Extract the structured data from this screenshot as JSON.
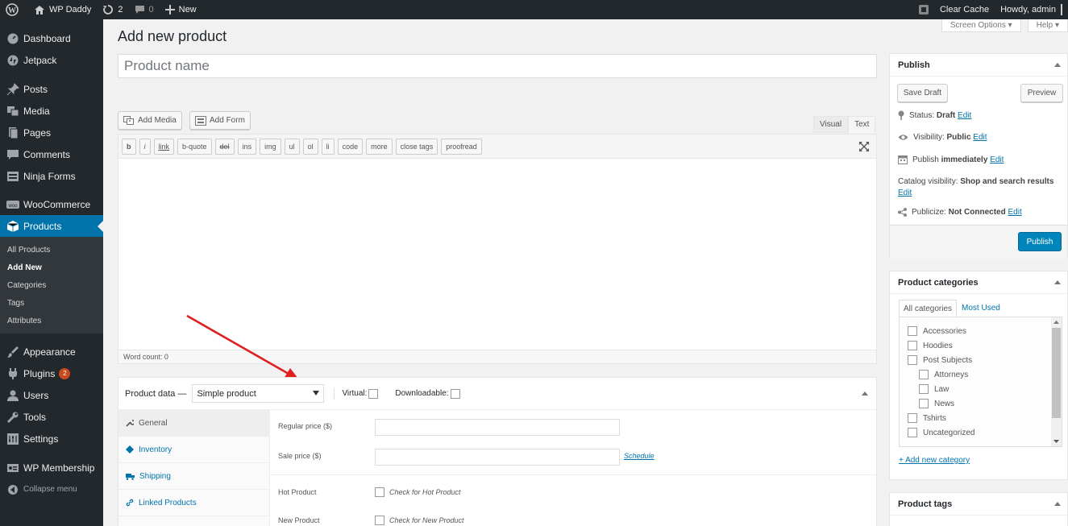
{
  "adminbar": {
    "site_name": "WP Daddy",
    "updates_count": "2",
    "comments_count": "0",
    "new_label": "New",
    "clear_cache": "Clear Cache",
    "howdy": "Howdy, admin"
  },
  "screen_options": {
    "screen_options_label": "Screen Options ▾",
    "help_label": "Help ▾"
  },
  "sidebar": {
    "items": [
      {
        "label": "Dashboard",
        "icon": "dashboard-icon"
      },
      {
        "label": "Jetpack",
        "icon": "jetpack-icon"
      },
      {
        "label": "Posts",
        "icon": "pin-icon"
      },
      {
        "label": "Media",
        "icon": "media-icon"
      },
      {
        "label": "Pages",
        "icon": "pages-icon"
      },
      {
        "label": "Comments",
        "icon": "comment-icon"
      },
      {
        "label": "Ninja Forms",
        "icon": "forms-icon"
      },
      {
        "label": "WooCommerce",
        "icon": "woo-icon"
      },
      {
        "label": "Products",
        "icon": "box-icon"
      },
      {
        "label": "Appearance",
        "icon": "brush-icon"
      },
      {
        "label": "Plugins",
        "icon": "plug-icon",
        "badge": "2"
      },
      {
        "label": "Users",
        "icon": "user-icon"
      },
      {
        "label": "Tools",
        "icon": "wrench-icon"
      },
      {
        "label": "Settings",
        "icon": "settings-icon"
      },
      {
        "label": "WP Membership",
        "icon": "membership-icon"
      },
      {
        "label": "Collapse menu",
        "icon": "collapse-icon"
      }
    ],
    "submenu": [
      "All Products",
      "Add New",
      "Categories",
      "Tags",
      "Attributes"
    ]
  },
  "page": {
    "title": "Add new product",
    "product_name_placeholder": "Product name",
    "add_media": "Add Media",
    "add_form": "Add Form",
    "tab_visual": "Visual",
    "tab_text": "Text",
    "quicktags": [
      "b",
      "i",
      "link",
      "b-quote",
      "del",
      "ins",
      "img",
      "ul",
      "ol",
      "li",
      "code",
      "more",
      "close tags",
      "proofread"
    ],
    "word_count": "Word count: 0"
  },
  "product_data": {
    "label": "Product data —",
    "type_selected": "Simple product",
    "virtual": "Virtual:",
    "downloadable": "Downloadable:",
    "tabs": [
      "General",
      "Inventory",
      "Shipping",
      "Linked Products"
    ],
    "regular_price": "Regular price ($)",
    "sale_price": "Sale price ($)",
    "schedule": "Schedule",
    "hot_product": "Hot Product",
    "hot_product_check": "Check for Hot Product",
    "new_product": "New Product",
    "new_product_check": "Check for New Product"
  },
  "publish": {
    "title": "Publish",
    "save_draft": "Save Draft",
    "preview": "Preview",
    "status_label": "Status:",
    "status_value": "Draft",
    "visibility_label": "Visibility:",
    "visibility_value": "Public",
    "publish_label": "Publish",
    "publish_value": "immediately",
    "catalog_label": "Catalog visibility:",
    "catalog_value": "Shop and search results",
    "publicize_label": "Publicize:",
    "publicize_value": "Not Connected",
    "edit": "Edit",
    "publish_button": "Publish"
  },
  "categories": {
    "title": "Product categories",
    "tab_all": "All categories",
    "tab_most_used": "Most Used",
    "items": [
      {
        "label": "Accessories",
        "level": 0
      },
      {
        "label": "Hoodies",
        "level": 0
      },
      {
        "label": "Post Subjects",
        "level": 0
      },
      {
        "label": "Attorneys",
        "level": 1
      },
      {
        "label": "Law",
        "level": 1
      },
      {
        "label": "News",
        "level": 1
      },
      {
        "label": "Tshirts",
        "level": 0
      },
      {
        "label": "Uncategorized",
        "level": 0
      }
    ],
    "add_new": "+ Add new category"
  },
  "tags": {
    "title": "Product tags"
  },
  "colors": {
    "primary": "#0073aa",
    "adminbar": "#23282d",
    "arrow": "#e02020"
  }
}
